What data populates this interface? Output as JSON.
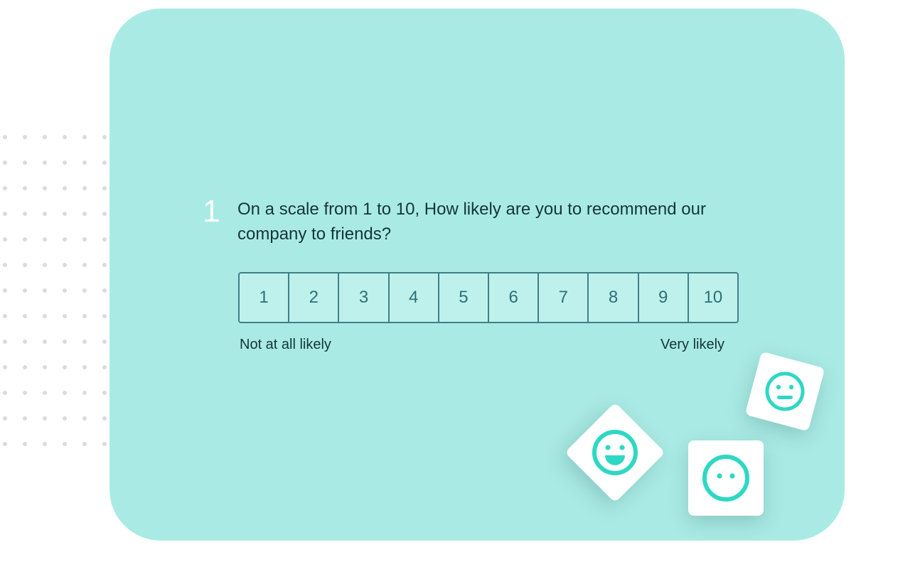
{
  "question": {
    "number": "1",
    "text": "On a scale from 1 to 10, How likely are you to recommend our company to friends?"
  },
  "scale": {
    "options": [
      "1",
      "2",
      "3",
      "4",
      "5",
      "6",
      "7",
      "8",
      "9",
      "10"
    ],
    "min_label": "Not at all likely",
    "max_label": "Very likely"
  },
  "emoji_tiles": [
    {
      "icon": "laughing-face-icon"
    },
    {
      "icon": "neutral-face-icon"
    },
    {
      "icon": "smile-face-icon"
    }
  ],
  "colors": {
    "card_background": "#a9ebe4",
    "accent": "#2ed8c3",
    "text": "#14343a",
    "scale_border": "#3f7f86"
  }
}
